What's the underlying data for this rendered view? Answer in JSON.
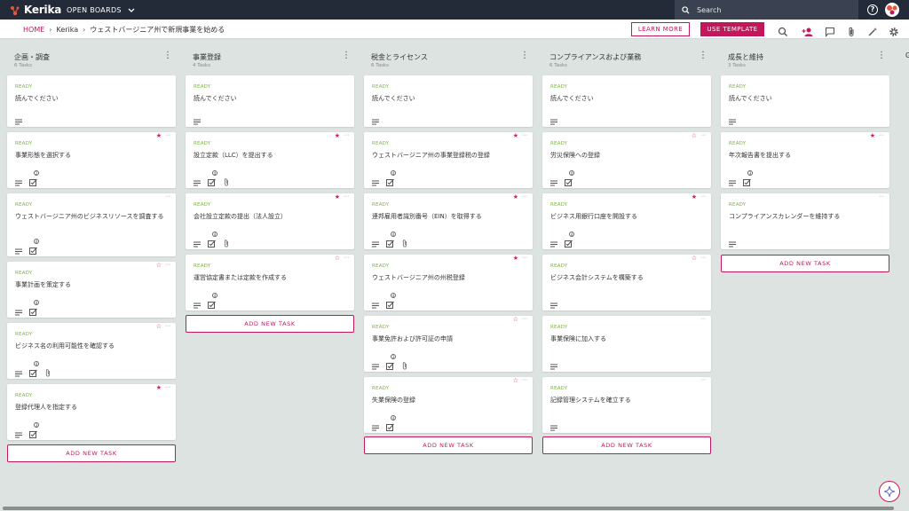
{
  "topbar": {
    "brand": "Kerika",
    "open_boards": "OPEN BOARDS",
    "search_placeholder": "Search"
  },
  "breadcrumb": {
    "home": "HOME",
    "org": "Kerika",
    "board": "ウェストバージニア州で新規事業を始める"
  },
  "actions": {
    "learn_more": "LEARN MORE",
    "use_template": "USE TEMPLATE"
  },
  "colors": {
    "accent": "#c2185b",
    "ready": "#7cb342",
    "topbar": "#232a38",
    "board_bg": "#dde3e0"
  },
  "add_task_label": "ADD NEW TASK",
  "columns": [
    {
      "title": "企画・調査",
      "count": "6 Tasks",
      "tasks": [
        {
          "status": "READY",
          "title": "読んでください",
          "star": "none",
          "todo": false,
          "attach": false,
          "todo_count": ""
        },
        {
          "status": "READY",
          "title": "事業形態を選択する",
          "star": "filled",
          "todo": true,
          "attach": false,
          "todo_count": "2"
        },
        {
          "status": "READY",
          "title": "ウェストバージニア州のビジネスリソースを調査する",
          "star": "none",
          "todo": true,
          "attach": false,
          "todo_count": "4"
        },
        {
          "status": "READY",
          "title": "事業計画を策定する",
          "star": "outline",
          "todo": true,
          "attach": false,
          "todo_count": "4"
        },
        {
          "status": "READY",
          "title": "ビジネス名の利用可能性を確認する",
          "star": "outline",
          "todo": true,
          "attach": true,
          "todo_count": "4"
        },
        {
          "status": "READY",
          "title": "登録代理人を指定する",
          "star": "filled",
          "todo": true,
          "attach": false,
          "todo_count": "3"
        }
      ]
    },
    {
      "title": "事業登録",
      "count": "4 Tasks",
      "tasks": [
        {
          "status": "READY",
          "title": "読んでください",
          "star": "none",
          "todo": false,
          "attach": false,
          "todo_count": ""
        },
        {
          "status": "READY",
          "title": "設立定款（LLC）を提出する",
          "star": "filled",
          "todo": true,
          "attach": true,
          "todo_count": "4"
        },
        {
          "status": "READY",
          "title": "会社設立定款の提出（法人設立）",
          "star": "filled",
          "todo": true,
          "attach": true,
          "todo_count": "4"
        },
        {
          "status": "READY",
          "title": "運営協定書または定款を作成する",
          "star": "outline",
          "todo": true,
          "attach": false,
          "todo_count": "4"
        }
      ]
    },
    {
      "title": "税金とライセンス",
      "count": "6 Tasks",
      "tasks": [
        {
          "status": "READY",
          "title": "読んでください",
          "star": "none",
          "todo": false,
          "attach": false,
          "todo_count": ""
        },
        {
          "status": "READY",
          "title": "ウェストバージニア州の事業登録税の登録",
          "star": "filled",
          "todo": true,
          "attach": false,
          "todo_count": "4"
        },
        {
          "status": "READY",
          "title": "連邦雇用者識別番号（EIN）を取得する",
          "star": "filled",
          "todo": true,
          "attach": true,
          "todo_count": "4"
        },
        {
          "status": "READY",
          "title": "ウェストバージニア州の州税登録",
          "star": "filled",
          "todo": true,
          "attach": false,
          "todo_count": "4"
        },
        {
          "status": "READY",
          "title": "事業免許および許可証の申請",
          "star": "outline",
          "todo": true,
          "attach": true,
          "todo_count": "3"
        },
        {
          "status": "READY",
          "title": "失業保険の登録",
          "star": "outline",
          "todo": true,
          "attach": false,
          "todo_count": "4"
        }
      ]
    },
    {
      "title": "コンプライアンスおよび業務",
      "count": "6 Tasks",
      "tasks": [
        {
          "status": "READY",
          "title": "読んでください",
          "star": "none",
          "todo": false,
          "attach": false,
          "todo_count": ""
        },
        {
          "status": "READY",
          "title": "労災保険への登録",
          "star": "outline",
          "todo": true,
          "attach": false,
          "todo_count": "4"
        },
        {
          "status": "READY",
          "title": "ビジネス用銀行口座を開設する",
          "star": "filled",
          "todo": true,
          "attach": false,
          "todo_count": "4"
        },
        {
          "status": "READY",
          "title": "ビジネス会計システムを構築する",
          "star": "outline",
          "todo": false,
          "attach": false,
          "todo_count": ""
        },
        {
          "status": "READY",
          "title": "事業保険に加入する",
          "star": "none",
          "todo": false,
          "attach": false,
          "todo_count": ""
        },
        {
          "status": "READY",
          "title": "記録管理システムを確立する",
          "star": "none",
          "todo": false,
          "attach": false,
          "todo_count": ""
        }
      ]
    },
    {
      "title": "成長と維持",
      "count": "3 Tasks",
      "tasks": [
        {
          "status": "READY",
          "title": "読んでください",
          "star": "none",
          "todo": false,
          "attach": false,
          "todo_count": ""
        },
        {
          "status": "READY",
          "title": "年次報告書を提出する",
          "star": "filled",
          "todo": true,
          "attach": false,
          "todo_count": "3"
        },
        {
          "status": "READY",
          "title": "コンプライアンスカレンダーを維持する",
          "star": "none",
          "todo": false,
          "attach": false,
          "todo_count": ""
        }
      ]
    }
  ]
}
